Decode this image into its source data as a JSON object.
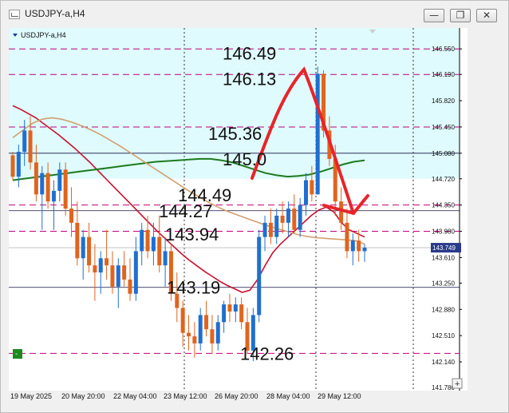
{
  "window": {
    "title": "USDJPY-a,H4",
    "buttons": {
      "minimize": "—",
      "restore": "❐",
      "close": "✕"
    }
  },
  "chart_data": {
    "type": "candlestick",
    "symbol_label": "USDJPY-a,H4",
    "ylim": [
      141.78,
      146.62
    ],
    "price_ticks": [
      "146.550",
      "146.190",
      "145.820",
      "145.450",
      "145.080",
      "144.720",
      "144.350",
      "143.980",
      "143.610",
      "143.250",
      "142.880",
      "142.510",
      "142.140",
      "141.780"
    ],
    "time_labels": [
      "19 May 2025",
      "20 May 20:00",
      "22 May 04:00",
      "23 May 12:00",
      "26 May 20:00",
      "28 May 04:00",
      "29 May 12:00"
    ],
    "current_price": "143.749",
    "candles": [
      [
        145.05,
        145.1,
        144.7,
        144.75
      ],
      [
        144.75,
        145.2,
        144.6,
        145.1
      ],
      [
        145.1,
        145.55,
        144.9,
        145.4
      ],
      [
        145.4,
        145.6,
        144.85,
        144.95
      ],
      [
        144.95,
        145.2,
        144.4,
        144.5
      ],
      [
        144.5,
        144.9,
        144.0,
        144.8
      ],
      [
        144.8,
        144.95,
        144.3,
        144.4
      ],
      [
        144.4,
        144.7,
        144.0,
        144.55
      ],
      [
        144.55,
        144.95,
        144.4,
        144.85
      ],
      [
        144.85,
        144.95,
        144.2,
        144.3
      ],
      [
        144.3,
        144.6,
        143.9,
        144.1
      ],
      [
        144.1,
        144.4,
        143.5,
        143.6
      ],
      [
        143.6,
        144.0,
        143.3,
        143.9
      ],
      [
        143.9,
        144.1,
        143.4,
        143.5
      ],
      [
        143.5,
        143.8,
        143.0,
        143.4
      ],
      [
        143.4,
        143.7,
        143.1,
        143.6
      ],
      [
        143.6,
        144.0,
        143.3,
        143.5
      ],
      [
        143.5,
        143.7,
        143.1,
        143.2
      ],
      [
        143.2,
        143.6,
        142.9,
        143.5
      ],
      [
        143.5,
        143.7,
        143.2,
        143.3
      ],
      [
        143.3,
        143.6,
        143.0,
        143.1
      ],
      [
        143.1,
        143.9,
        143.0,
        143.7
      ],
      [
        143.7,
        144.1,
        143.5,
        144.0
      ],
      [
        144.0,
        144.2,
        143.6,
        143.7
      ],
      [
        143.7,
        144.1,
        143.5,
        143.9
      ],
      [
        143.9,
        144.2,
        143.4,
        143.5
      ],
      [
        143.5,
        143.9,
        143.2,
        143.7
      ],
      [
        143.7,
        143.8,
        143.0,
        143.1
      ],
      [
        143.1,
        143.4,
        142.7,
        142.9
      ],
      [
        142.9,
        143.0,
        142.35,
        142.55
      ],
      [
        142.55,
        142.8,
        142.3,
        142.5
      ],
      [
        142.5,
        142.7,
        142.2,
        142.4
      ],
      [
        142.4,
        142.9,
        142.3,
        142.8
      ],
      [
        142.8,
        143.0,
        142.5,
        142.6
      ],
      [
        142.6,
        142.8,
        142.25,
        142.4
      ],
      [
        142.4,
        142.8,
        142.3,
        142.7
      ],
      [
        142.7,
        143.0,
        142.55,
        142.95
      ],
      [
        142.95,
        143.1,
        142.7,
        142.85
      ],
      [
        142.85,
        143.05,
        142.7,
        142.95
      ],
      [
        142.95,
        143.05,
        142.6,
        142.7
      ],
      [
        142.7,
        142.9,
        142.25,
        142.3
      ],
      [
        142.3,
        142.9,
        142.15,
        142.8
      ],
      [
        142.8,
        144.0,
        142.7,
        143.9
      ],
      [
        143.9,
        144.2,
        143.7,
        144.1
      ],
      [
        144.1,
        144.3,
        143.8,
        143.9
      ],
      [
        143.9,
        144.3,
        143.8,
        144.2
      ],
      [
        144.2,
        144.4,
        143.95,
        144.1
      ],
      [
        144.1,
        144.4,
        143.9,
        144.3
      ],
      [
        144.3,
        144.5,
        143.95,
        144.0
      ],
      [
        144.0,
        144.45,
        143.9,
        144.35
      ],
      [
        144.35,
        144.8,
        144.2,
        144.7
      ],
      [
        144.7,
        144.9,
        144.4,
        144.5
      ],
      [
        144.5,
        146.3,
        144.5,
        146.2
      ],
      [
        146.2,
        146.25,
        145.3,
        145.4
      ],
      [
        145.4,
        145.6,
        144.9,
        145.0
      ],
      [
        145.0,
        145.2,
        144.2,
        144.4
      ],
      [
        144.4,
        144.6,
        144.0,
        144.1
      ],
      [
        144.1,
        144.3,
        143.6,
        143.7
      ],
      [
        143.7,
        143.95,
        143.5,
        143.85
      ],
      [
        143.85,
        144.0,
        143.55,
        143.7
      ],
      [
        143.7,
        143.8,
        143.55,
        143.75
      ]
    ],
    "moving_averages": [
      {
        "color": "#c8102e",
        "values": [
          145.75,
          145.7,
          145.64,
          145.58,
          145.5,
          145.42,
          145.34,
          145.25,
          145.16,
          145.06,
          144.96,
          144.85,
          144.74,
          144.63,
          144.52,
          144.41,
          144.3,
          144.19,
          144.08,
          143.97,
          143.87,
          143.77,
          143.67,
          143.58,
          143.5,
          143.42,
          143.35,
          143.28,
          143.22,
          143.17,
          143.12,
          143.15,
          143.3,
          143.5,
          143.68,
          143.8,
          143.9,
          144.0,
          144.1,
          144.2,
          144.28,
          144.32,
          144.25,
          144.1,
          144.0,
          143.95,
          143.9
        ]
      },
      {
        "color": "#1e7a1e",
        "values": [
          144.7,
          144.72,
          144.74,
          144.76,
          144.78,
          144.8,
          144.82,
          144.84,
          144.86,
          144.88,
          144.9,
          144.92,
          144.94,
          144.96,
          144.97,
          144.98,
          144.99,
          145.0,
          145.0,
          144.98,
          144.95,
          144.9,
          144.85,
          144.8,
          144.77,
          144.75,
          144.76,
          144.78,
          144.82,
          144.87,
          144.92,
          144.96,
          144.98
        ]
      },
      {
        "color": "#d2a070",
        "values": [
          145.3,
          145.4,
          145.5,
          145.56,
          145.58,
          145.56,
          145.52,
          145.47,
          145.41,
          145.34,
          145.26,
          145.18,
          145.09,
          145.0,
          144.91,
          144.82,
          144.73,
          144.64,
          144.55,
          144.47,
          144.39,
          144.32,
          144.26,
          144.21,
          144.16,
          144.11,
          144.06,
          144.02,
          143.98,
          143.94,
          143.91,
          143.89,
          143.88,
          143.87,
          143.86,
          143.85,
          143.8
        ]
      }
    ],
    "level_annotations": [
      {
        "text": "146.49",
        "price": 146.49
      },
      {
        "text": "146.13",
        "price": 146.13
      },
      {
        "text": "145.36",
        "price": 145.36
      },
      {
        "text": "145.0",
        "price": 145.0
      },
      {
        "text": "144.49",
        "price": 144.49
      },
      {
        "text": "144.27",
        "price": 144.27
      },
      {
        "text": "143.94",
        "price": 143.94
      },
      {
        "text": "143.19",
        "price": 143.19
      },
      {
        "text": "142.26",
        "price": 142.26
      }
    ],
    "colors": {
      "bull": "#1f6fd0",
      "bear": "#e0641e",
      "background": "#ffffff",
      "highlight": "#dffbfd",
      "levels": "#c0007a",
      "drawing": "#e8242a"
    }
  }
}
